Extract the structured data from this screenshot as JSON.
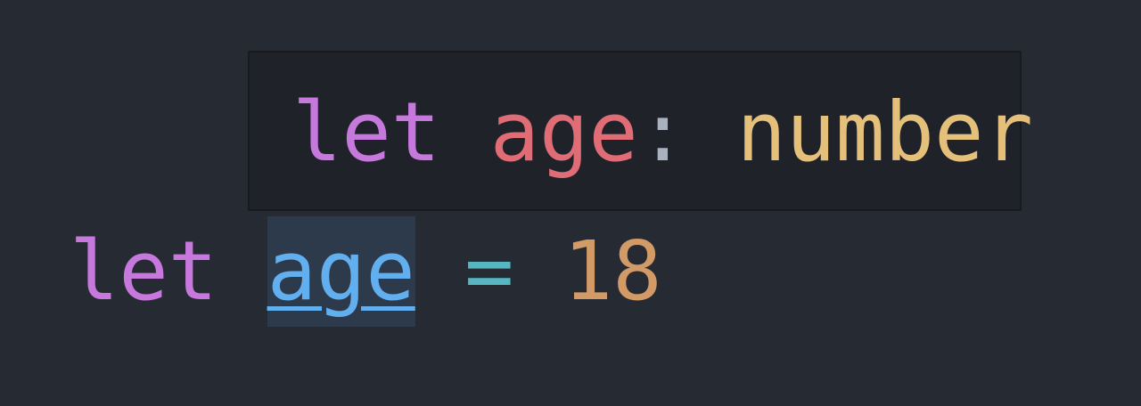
{
  "hover": {
    "keyword": "let",
    "name": "age",
    "colon": ":",
    "type": "number"
  },
  "code": {
    "keyword": "let",
    "name": "age",
    "operator": "=",
    "value": "18"
  },
  "colors": {
    "background": "#262a33",
    "tooltip_background": "#1f2228",
    "keyword": "#c678dd",
    "variable_hover": "#e06c75",
    "variable_selected": "#61afef",
    "type": "#e5c07b",
    "operator": "#56b6c2",
    "number": "#d19a66",
    "selection": "#2c3a4c"
  }
}
